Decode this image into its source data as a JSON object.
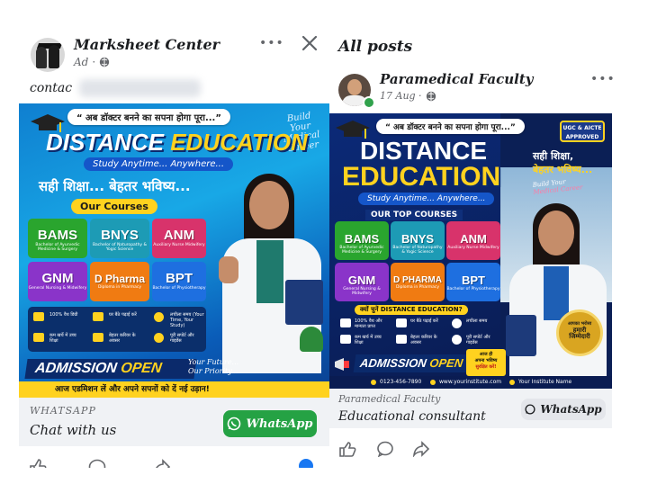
{
  "left_post": {
    "page_name": "Marksheet Center",
    "meta_label": "Ad",
    "body_text_visible": "contac",
    "more_menu": "•••",
    "close": "×",
    "poster": {
      "quote": "“ अब डॉक्टर बनने का सपना होगा पूरा...”",
      "title_part1": "DISTANCE",
      "title_part2": "EDUCATION",
      "tagline": "Study Anytime... Anywhere...",
      "side_text_1": "Build",
      "side_text_2": "Your Medical",
      "side_text_3": "Career",
      "hindi_line": "सही शिक्षा... बेहतर भविष्य...",
      "courses_title": "Our Courses",
      "courses": [
        {
          "code": "BAMS",
          "desc": "Bachelor of Ayurvedic Medicine & Surgery",
          "color": "#2aa52e"
        },
        {
          "code": "BNYS",
          "desc": "Bachelor of Naturopathy & Yogic Science",
          "color": "#1d9bb5"
        },
        {
          "code": "ANM",
          "desc": "Auxiliary Nurse Midwifery",
          "color": "#d8336b"
        },
        {
          "code": "GNM",
          "desc": "General Nursing & Midwifery",
          "color": "#8a34c9"
        },
        {
          "code": "D Pharma",
          "desc": "Diploma in Pharmacy",
          "color": "#f07b12"
        },
        {
          "code": "BPT",
          "desc": "Bachelor of Physiotherapy",
          "color": "#1e6fe0"
        }
      ],
      "features": [
        {
          "text": "100% वैध डिग्री"
        },
        {
          "text": "घर बैठे पढ़ाई करें"
        },
        {
          "text": "लचीला समय (Your Time, Your Study)"
        },
        {
          "text": "कम खर्चे में उच्च शिक्षा"
        },
        {
          "text": "बेहतर करियर के अवसर"
        },
        {
          "text": "पूरी सपोर्ट और गाइडेंस"
        }
      ],
      "admission_1": "ADMISSION",
      "admission_2": "OPEN",
      "future_1": "Your Future...",
      "future_2": "Our Priority...",
      "bottom_line": "आज एडमिशन लें और अपने सपनों को दें नई उड़ान!"
    },
    "cta_source": "WHATSAPP",
    "cta_title": "Chat with us",
    "cta_button": "WhatsApp"
  },
  "right_section": {
    "header": "All posts",
    "page_name": "Paramedical Faculty",
    "date": "17 Aug ·",
    "more_menu": "•••",
    "poster": {
      "quote": "“ अब डॉक्टर बनने का सपना होगा पूरा...”",
      "title_part1": "DISTANCE",
      "title_part2": "EDUCATION",
      "badge": "UGC & AICTE APPROVED",
      "hindi_1": "सही शिक्षा,",
      "hindi_2": "बेहतर भविष्य...",
      "side_1": "Build Your",
      "side_2": "Medical Career",
      "tagline": "Study Anytime... Anywhere...",
      "courses_title": "OUR TOP COURSES",
      "courses": [
        {
          "code": "BAMS",
          "desc": "Bachelor of Ayurvedic Medicine & Surgery",
          "color": "#2aa52e"
        },
        {
          "code": "BNYS",
          "desc": "Bachelor of Naturopathy & Yogic Science",
          "color": "#1d9bb5"
        },
        {
          "code": "ANM",
          "desc": "Auxiliary Nurse Midwifery",
          "color": "#d8336b"
        },
        {
          "code": "GNM",
          "desc": "General Nursing & Midwifery",
          "color": "#8a34c9"
        },
        {
          "code": "D PHARMA",
          "desc": "Diploma in Pharmacy",
          "color": "#f07b12"
        },
        {
          "code": "BPT",
          "desc": "Bachelor of Physiotherapy",
          "color": "#1e6fe0"
        }
      ],
      "why_title": "क्यों चुनें DISTANCE EDUCATION?",
      "features": [
        {
          "text": "100% वैध और मान्यता प्राप्त"
        },
        {
          "text": "घर बैठे पढ़ाई करें"
        },
        {
          "text": "लचीला समय"
        },
        {
          "text": "कम खर्च में उच्च शिक्षा"
        },
        {
          "text": "बेहतर करियर के अवसर"
        },
        {
          "text": "पूरी सपोर्ट और गाइडेंस"
        }
      ],
      "medal_1": "आपका भरोसा",
      "medal_2": "हमारी",
      "medal_3": "जिम्मेदारी",
      "admission_1": "ADMISSION",
      "admission_2": "OPEN",
      "secure_1": "आज ही",
      "secure_2": "अपना भविष्य",
      "secure_3": "सुरक्षित करें!",
      "phone": "0123-456-7890",
      "website": "www.yourinstitute.com",
      "institute": "Your Institute Name"
    },
    "cta_source": "Paramedical Faculty",
    "cta_title": "Educational consultant",
    "cta_button": "WhatsApp"
  },
  "colors": {
    "whatsapp_green": "#25a244",
    "facebook_blue": "#1877f2",
    "poster_yellow": "#ffd21f"
  }
}
